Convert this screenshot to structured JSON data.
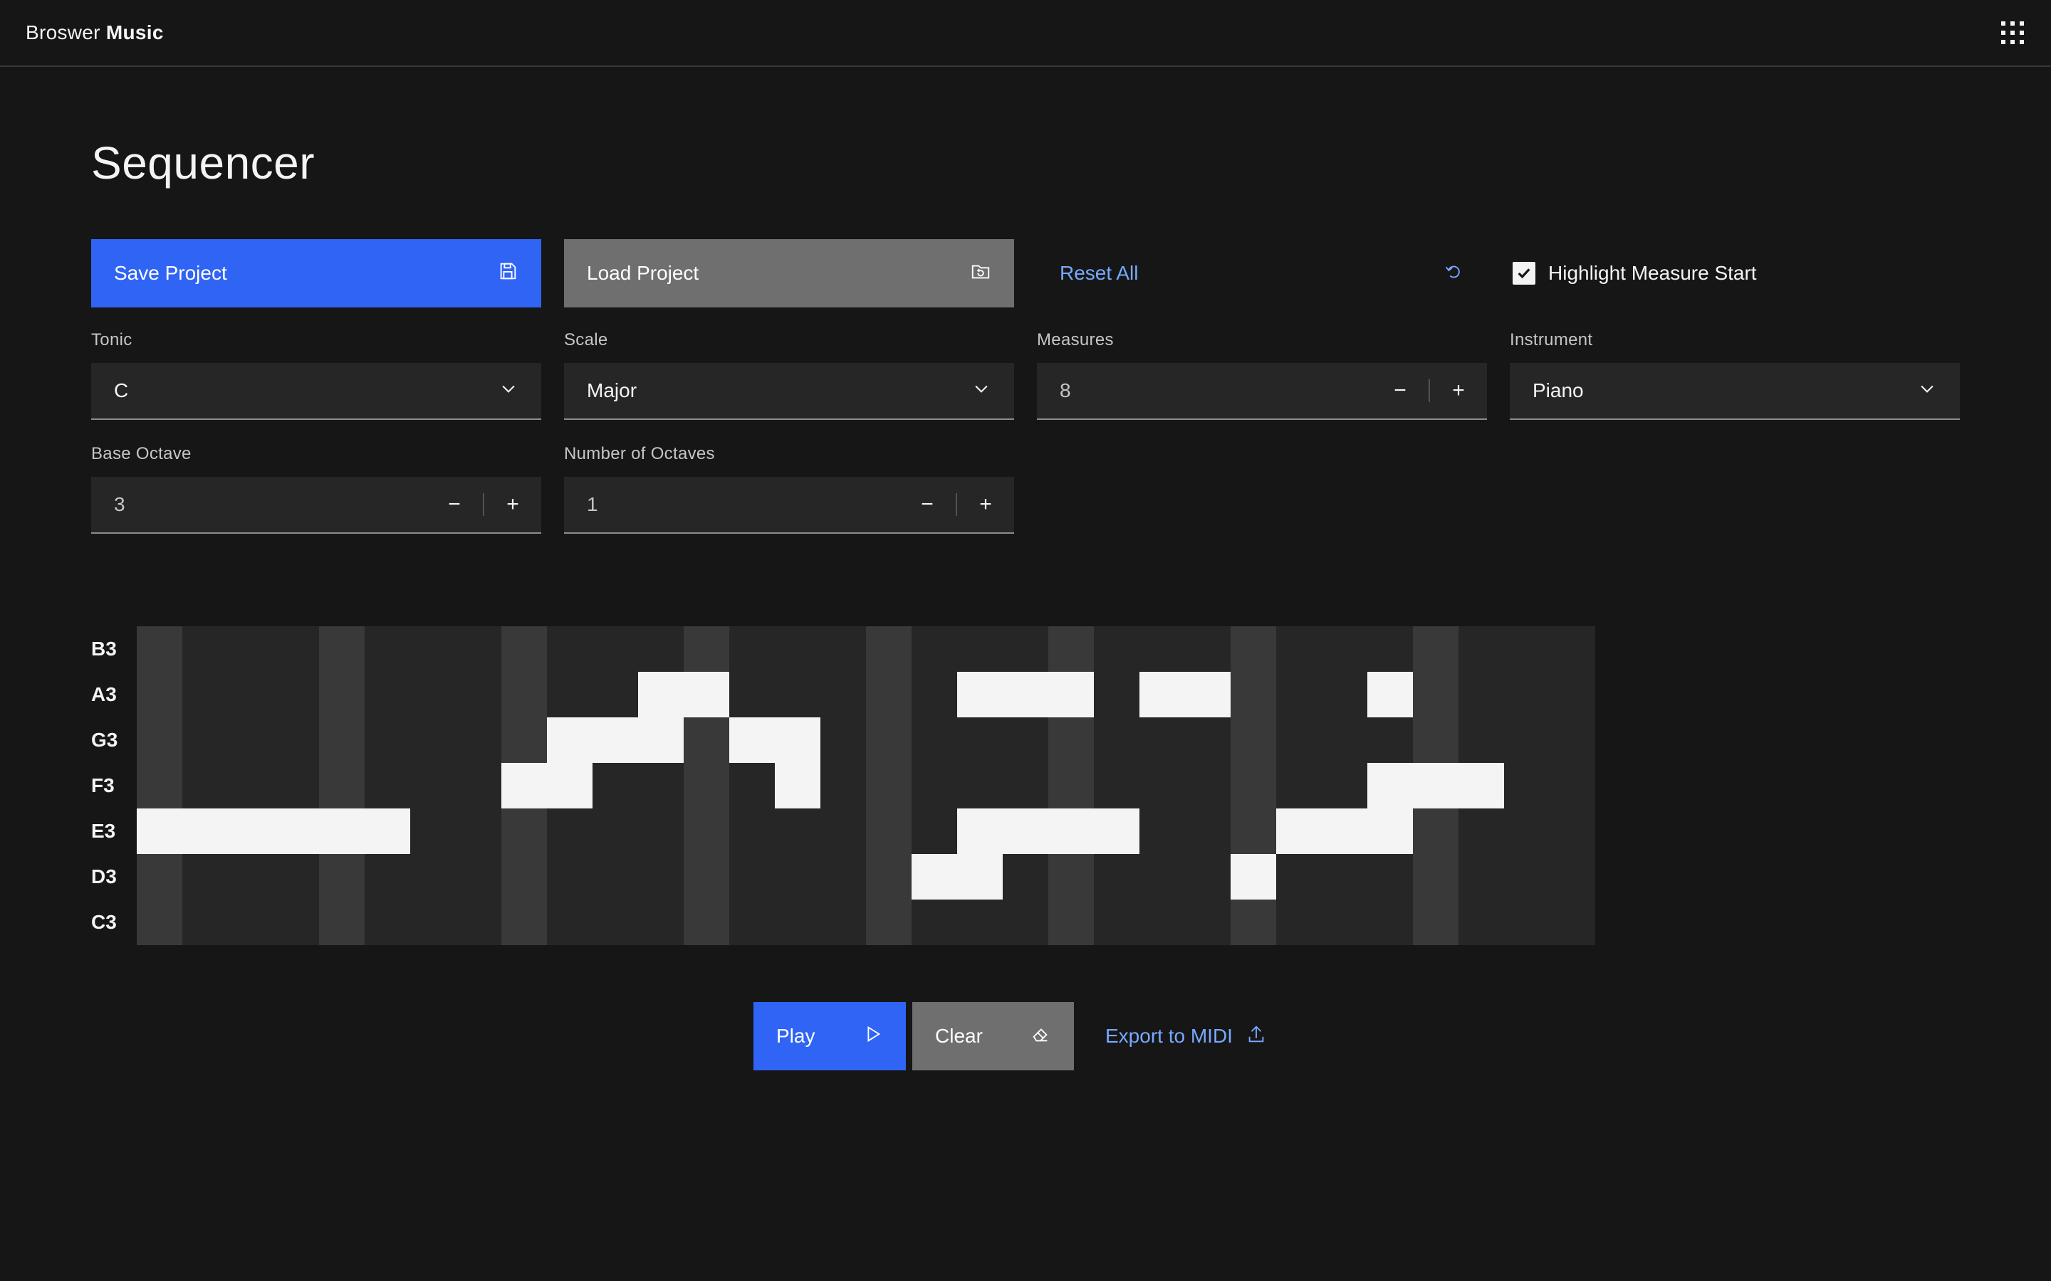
{
  "header": {
    "brand_light": "Broswer",
    "brand_bold": "Music",
    "menu_icon": "app-switcher-icon"
  },
  "page": {
    "title": "Sequencer"
  },
  "toolbar": {
    "save_label": "Save Project",
    "save_icon": "save-icon",
    "load_label": "Load Project",
    "load_icon": "folder-load-icon",
    "reset_label": "Reset All",
    "reset_icon": "reset-icon",
    "highlight_label": "Highlight Measure Start",
    "highlight_checked": true
  },
  "controls": {
    "tonic": {
      "label": "Tonic",
      "value": "C"
    },
    "scale": {
      "label": "Scale",
      "value": "Major"
    },
    "measures": {
      "label": "Measures",
      "value": "8"
    },
    "instrument": {
      "label": "Instrument",
      "value": "Piano"
    },
    "base_octave": {
      "label": "Base Octave",
      "value": "3"
    },
    "num_octaves": {
      "label": "Number of Octaves",
      "value": "1"
    },
    "decrement": "−",
    "increment": "+"
  },
  "sequencer": {
    "rows": [
      "B3",
      "A3",
      "G3",
      "F3",
      "E3",
      "D3",
      "C3"
    ],
    "steps": 32,
    "beats_per_measure": 4,
    "notes": [
      {
        "row": "E3",
        "steps": [
          0,
          1,
          2,
          3,
          4,
          5
        ]
      },
      {
        "row": "F3",
        "steps": [
          8,
          9
        ]
      },
      {
        "row": "G3",
        "steps": [
          9,
          10,
          11
        ]
      },
      {
        "row": "A3",
        "steps": [
          11,
          12
        ]
      },
      {
        "row": "G3",
        "steps": [
          13,
          14
        ]
      },
      {
        "row": "F3",
        "steps": [
          14
        ]
      },
      {
        "row": "D3",
        "steps": [
          17,
          18
        ]
      },
      {
        "row": "E3",
        "steps": [
          18,
          19,
          20,
          21
        ]
      },
      {
        "row": "A3",
        "steps": [
          18,
          19,
          20
        ]
      },
      {
        "row": "A3",
        "steps": [
          22,
          23
        ]
      },
      {
        "row": "D3",
        "steps": [
          24
        ]
      },
      {
        "row": "E3",
        "steps": [
          25,
          26,
          27
        ]
      },
      {
        "row": "F3",
        "steps": [
          27,
          28,
          29
        ]
      },
      {
        "row": "A3",
        "steps": [
          27
        ]
      }
    ],
    "colors": {
      "background": "#262626",
      "measure_start": "#393939",
      "note": "#f4f4f4"
    }
  },
  "transport": {
    "play_label": "Play",
    "play_icon": "play-icon",
    "clear_label": "Clear",
    "clear_icon": "eraser-icon",
    "export_label": "Export to MIDI",
    "export_icon": "upload-icon"
  },
  "colors": {
    "primary": "#2f64f5",
    "secondary": "#6f6f6f",
    "link": "#78a9ff",
    "background": "#161616",
    "field": "#262626"
  }
}
